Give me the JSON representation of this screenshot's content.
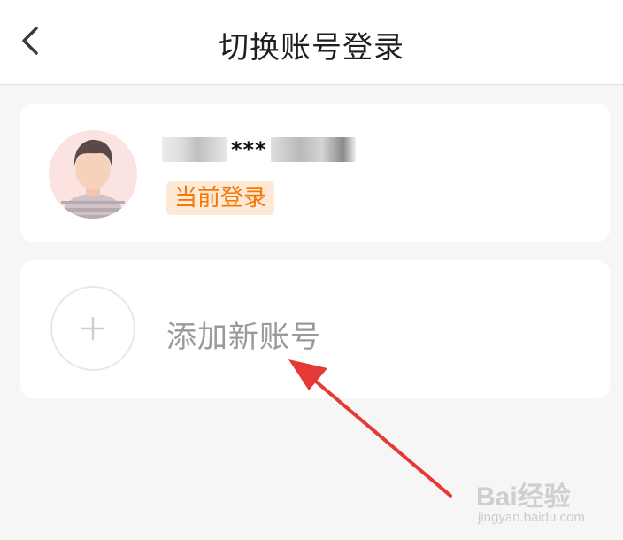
{
  "header": {
    "title": "切换账号登录",
    "back_icon": "chevron-left-icon"
  },
  "current_account": {
    "masked_name": "***",
    "status_badge": "当前登录",
    "avatar_icon": "avatar-male-icon"
  },
  "add_account": {
    "label": "添加新账号",
    "icon": "plus-icon"
  },
  "annotation": {
    "arrow_color": "#e53935"
  },
  "watermark": {
    "brand": "Bai经验",
    "sub": "jingyan.baidu.com"
  },
  "colors": {
    "accent_orange": "#f4790a",
    "badge_background": "#fde9d6",
    "page_background": "#f6f6f6"
  }
}
